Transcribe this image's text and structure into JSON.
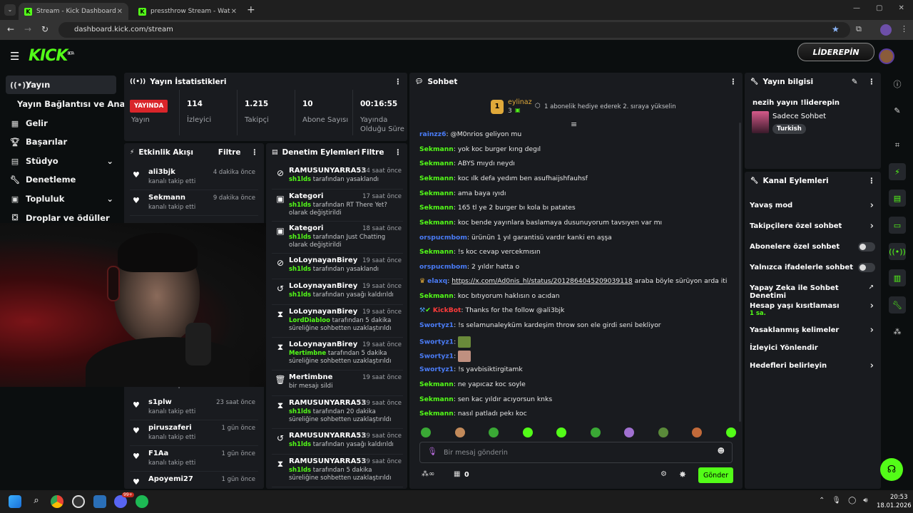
{
  "browser": {
    "tabs": [
      {
        "title": "Stream - Kick Dashboard",
        "active": true
      },
      {
        "title": "pressthrow Stream - Watch Live",
        "active": false
      }
    ],
    "url": "dashboard.kick.com/stream"
  },
  "brand": {
    "logo": "KICK",
    "beta": "BETA",
    "sponsor": "LİDEREPİN",
    "accent": "#53fc18"
  },
  "sidebar": {
    "items": [
      {
        "label": "Yayın",
        "icon": "broadcast-icon"
      },
      {
        "label": "Yayın Bağlantısı ve Anahtarı",
        "icon": ""
      },
      {
        "label": "Gelir",
        "icon": "revenue-icon"
      },
      {
        "label": "Başarılar",
        "icon": "trophy-icon"
      },
      {
        "label": "Stüdyo",
        "icon": "studio-icon"
      },
      {
        "label": "Denetleme",
        "icon": "wrench-icon"
      },
      {
        "label": "Topluluk",
        "icon": "community-icon"
      },
      {
        "label": "Droplar ve ödüller",
        "icon": "gift-icon"
      }
    ]
  },
  "stats": {
    "title": "Yayın İstatistikleri",
    "live_badge": "YAYINDA",
    "items": [
      {
        "value": "",
        "label": "Yayın"
      },
      {
        "value": "114",
        "label": "İzleyici"
      },
      {
        "value": "1.215",
        "label": "Takipçi"
      },
      {
        "value": "10",
        "label": "Abone Sayısı"
      },
      {
        "value": "00:16:55",
        "label": "Yayında Olduğu Süre"
      }
    ]
  },
  "activity": {
    "title": "Etkinlik Akışı",
    "filter": "Filtre",
    "events": [
      {
        "name": "ali3bjk",
        "sub": "kanalı takip etti",
        "time": "4 dakika önce"
      },
      {
        "name": "Sekmann",
        "sub": "kanalı takip etti",
        "time": "9 dakika önce"
      },
      {
        "name": "s1plw",
        "sub": "kanalı takip etti",
        "time": "23 saat önce"
      },
      {
        "name": "piruszaferi",
        "sub": "kanalı takip etti",
        "time": "1 gün önce"
      },
      {
        "name": "F1Aa",
        "sub": "kanalı takip etti",
        "time": "1 gün önce"
      },
      {
        "name": "Apoyemi27",
        "sub": "",
        "time": "1 gün önce"
      }
    ],
    "partial_sub": "kanalı takip etti"
  },
  "moderation": {
    "title": "Denetim Eylemleri",
    "filter": "Filtre",
    "actions": [
      {
        "icon": "ban-icon",
        "name": "RAMUSUNYARRA53",
        "actor": "sh1lds",
        "desc": "tarafından yasaklandı",
        "time": "14 saat önce"
      },
      {
        "icon": "category-icon",
        "name": "Kategori",
        "actor": "sh1lds",
        "desc": "tarafından RT There Yet? olarak değiştirildi",
        "time": "17 saat önce"
      },
      {
        "icon": "category-icon",
        "name": "Kategori",
        "actor": "sh1lds",
        "desc": "tarafından Just Chatting olarak değiştirildi",
        "time": "18 saat önce"
      },
      {
        "icon": "ban-icon",
        "name": "LoLoynayanBirey",
        "actor": "sh1lds",
        "desc": "tarafından yasaklandı",
        "time": "19 saat önce"
      },
      {
        "icon": "unban-icon",
        "name": "LoLoynayanBirey",
        "actor": "sh1lds",
        "desc": "tarafından yasağı kaldırıldı",
        "time": "19 saat önce"
      },
      {
        "icon": "timeout-icon",
        "name": "LoLoynayanBirey",
        "actor": "LordDiabloo",
        "desc": "tarafından 5 dakika süreliğine sohbetten uzaklaştırıldı",
        "time": "19 saat önce"
      },
      {
        "icon": "timeout-icon",
        "name": "LoLoynayanBirey",
        "actor": "Mertimbne",
        "desc": "tarafından 5 dakika süreliğine sohbetten uzaklaştırıldı",
        "time": "19 saat önce"
      },
      {
        "icon": "trash-icon",
        "name": "Mertimbne",
        "actor": "",
        "desc": "bir mesajı sildi",
        "time": "19 saat önce"
      },
      {
        "icon": "timeout-icon",
        "name": "RAMUSUNYARRA53",
        "actor": "sh1lds",
        "desc": "tarafından 20 dakika süreliğine sohbetten uzaklaştırıldı",
        "time": "19 saat önce"
      },
      {
        "icon": "unban-icon",
        "name": "RAMUSUNYARRA53",
        "actor": "sh1lds",
        "desc": "tarafından yasağı kaldırıldı",
        "time": "19 saat önce"
      },
      {
        "icon": "timeout-icon",
        "name": "RAMUSUNYARRA53",
        "actor": "sh1lds",
        "desc": "tarafından 5 dakika süreliğine sohbetten uzaklaştırıldı",
        "time": "19 saat önce"
      }
    ]
  },
  "chat": {
    "title": "Sohbet",
    "pinned": {
      "rank": "1",
      "user": "eylinaz",
      "count": "3",
      "text": "1 abonelik hediye ederek 2. sıraya yükselin"
    },
    "messages": [
      {
        "user": "rainzz6",
        "color": "#4a7cf7",
        "text": "@M0nrios geliyon mu"
      },
      {
        "user": "Sekmann",
        "color": "#53fc18",
        "text": "yok koc burger kıng degıl"
      },
      {
        "user": "Sekmann",
        "color": "#53fc18",
        "text": "ABYS mıydı neydı"
      },
      {
        "user": "Sekmann",
        "color": "#53fc18",
        "text": "koc ılk defa yedım ben asufhaijshfauhsf"
      },
      {
        "user": "Sekmann",
        "color": "#53fc18",
        "text": "ama baya ıyıdı"
      },
      {
        "user": "Sekmann",
        "color": "#53fc18",
        "text": "165 tl ye 2 burger bı kola bı patates"
      },
      {
        "user": "Sekmann",
        "color": "#53fc18",
        "text": "koc bende yayınlara baslamaya dusunuyorum tavsıyen var mı"
      },
      {
        "user": "orspucmbom",
        "color": "#4a7cf7",
        "text": "ürünün 1 yıl garantisü vardır kanki en aşşa"
      },
      {
        "user": "Sekmann",
        "color": "#53fc18",
        "text": "!s koc cevap vercekmısın"
      },
      {
        "user": "orspucmbom",
        "color": "#4a7cf7",
        "text": "2 yıldır hatta o"
      },
      {
        "user": "elaxq",
        "color": "#4a7cf7",
        "text": "https://x.com/Ad0nis_hl/status/2012864045209039118 araba böyle sürüyon arda iti",
        "link": "https://x.com/Ad0nis_hl/status/2012864045209039118"
      },
      {
        "user": "Sekmann",
        "color": "#53fc18",
        "text": "koc bıtıyorum haklısın o acıdan"
      },
      {
        "user": "KickBot",
        "color": "#ff3b3b",
        "text": "Thanks for the follow @ali3bjk"
      },
      {
        "user": "Swortyz1",
        "color": "#4a7cf7",
        "text": "!s selamunaleyküm kardeşim throw son ele girdi seni bekliyor"
      },
      {
        "user": "Swortyz1",
        "color": "#4a7cf7",
        "text": ""
      },
      {
        "user": "Swortyz1",
        "color": "#4a7cf7",
        "text": ""
      },
      {
        "user": "Swortyz1",
        "color": "#4a7cf7",
        "text": "!s yavbisiktirgitamk"
      },
      {
        "user": "Sekmann",
        "color": "#53fc18",
        "text": "ne yapıcaz koc soyle"
      },
      {
        "user": "Sekmann",
        "color": "#53fc18",
        "text": "sen kac yıldır acıyorsun knks"
      },
      {
        "user": "Sekmann",
        "color": "#53fc18",
        "text": "nasıl patladı pekı koc"
      }
    ],
    "input_placeholder": "Bir mesaj gönderin",
    "points": "0",
    "send": "Gönder"
  },
  "stream_info": {
    "title": "Yayın bilgisi",
    "stream_title": "nezih yayın !liderepin",
    "category": "Sadece Sohbet",
    "tag": "Turkish"
  },
  "channel_actions": {
    "title": "Kanal Eylemleri",
    "items": [
      {
        "label": "Yavaş mod",
        "sub": "",
        "control": "chevron"
      },
      {
        "label": "Takipçilere özel sohbet",
        "sub": "",
        "control": "chevron"
      },
      {
        "label": "Abonelere özel sohbet",
        "sub": "",
        "control": "toggle"
      },
      {
        "label": "Yalnızca ifadelerle sohbet",
        "sub": "",
        "control": "toggle"
      },
      {
        "label": "Yapay Zeka ile Sohbet Denetimi",
        "sub": "",
        "control": "external"
      },
      {
        "label": "Hesap yaşı kısıtlaması",
        "sub": "1 sa.",
        "control": "chevron"
      },
      {
        "label": "Yasaklanmış kelimeler",
        "sub": "",
        "control": "chevron"
      },
      {
        "label": "İzleyici Yönlendir",
        "sub": "",
        "control": "none"
      },
      {
        "label": "Hedefleri belirleyin",
        "sub": "",
        "control": "chevron"
      }
    ]
  },
  "taskbar": {
    "time": "20:53",
    "date": "18.01.2026",
    "badge": "99+"
  }
}
